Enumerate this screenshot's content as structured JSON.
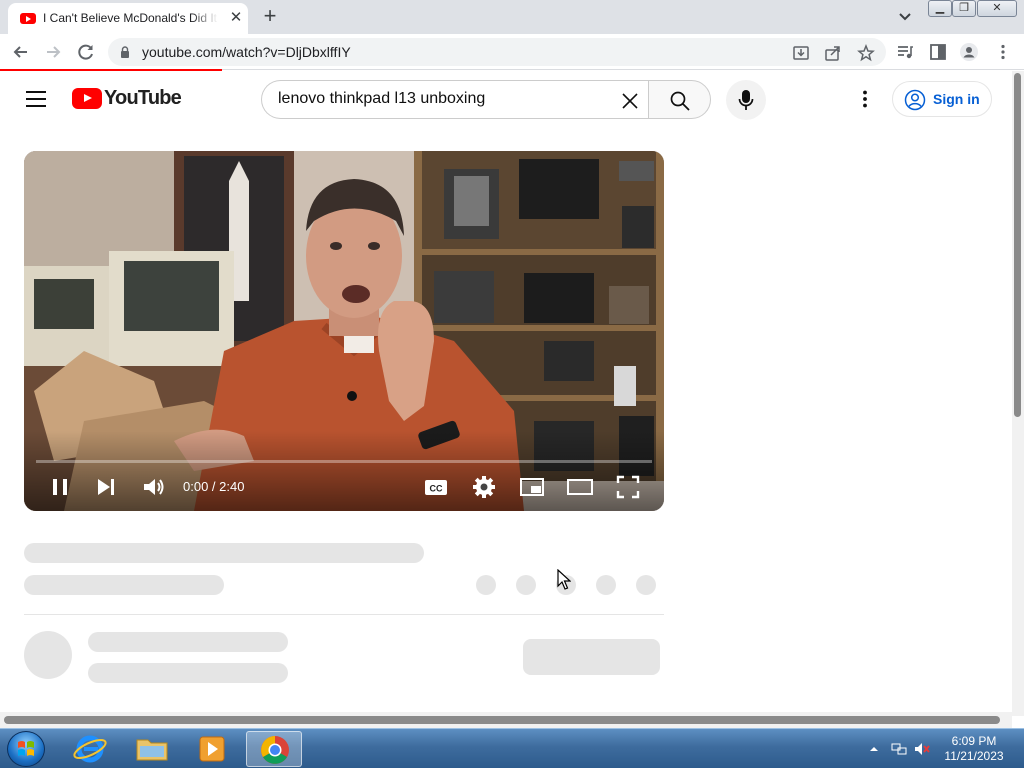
{
  "browser": {
    "tab_title": "I Can't Believe McDonald's Did It",
    "url": "youtube.com/watch?v=DljDbxlffIY"
  },
  "youtube": {
    "logo_text": "YouTube",
    "search_value": "lenovo thinkpad l13 unboxing",
    "signin_label": "Sign in"
  },
  "player": {
    "time_display": "0:00 / 2:40",
    "progress_fraction": 0.0,
    "state": "playing"
  },
  "taskbar": {
    "time": "6:09 PM",
    "date": "11/21/2023"
  },
  "colors": {
    "youtube_red": "#ff0000",
    "link_blue": "#065fd4",
    "skeleton": "#e5e5e5"
  },
  "icons": [
    "youtube-favicon",
    "close-icon",
    "plus-icon",
    "chevron-down-icon",
    "arrow-left-icon",
    "arrow-right-icon",
    "reload-icon",
    "lock-icon",
    "download-icon",
    "share-icon",
    "star-icon",
    "media-icon",
    "side-panel-icon",
    "profile-icon",
    "kebab-icon",
    "menu-icon",
    "search-icon",
    "clear-icon",
    "mic-icon",
    "account-icon",
    "pause-icon",
    "next-icon",
    "volume-icon",
    "captions-icon",
    "settings-icon",
    "miniplayer-icon",
    "theater-icon",
    "fullscreen-icon",
    "windows-start-icon",
    "ie-icon",
    "explorer-icon",
    "media-player-icon",
    "chrome-icon",
    "network-icon",
    "muted-speaker-icon"
  ]
}
